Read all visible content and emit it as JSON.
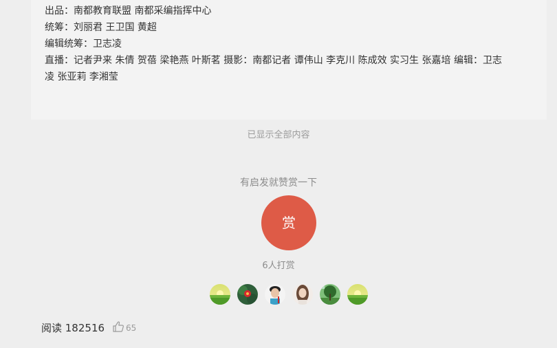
{
  "credits": {
    "producer": "出品：南都教育联盟 南都采编指挥中心",
    "coordinators": "统筹：刘丽君 王卫国 黄超",
    "editor_coordinator": "编辑统筹：卫志凌",
    "live_line1": "直播：记者尹来 朱倩 贺蓓 梁艳燕 叶斯茗 摄影：南都记者 谭伟山 李克川 陈成效 实习生 张嘉培 编辑：卫志",
    "live_line2": "凌 张亚莉 李湘莹"
  },
  "status": {
    "shown_all": "已显示全部内容"
  },
  "reward": {
    "prompt": "有启发就赞赏一下",
    "button_label": "赏",
    "count_text": "6人打赏",
    "button_color": "#de5b47"
  },
  "footer": {
    "read_label": "阅读 182516",
    "like_count": "65",
    "like_icon": "thumbs-up-icon"
  }
}
